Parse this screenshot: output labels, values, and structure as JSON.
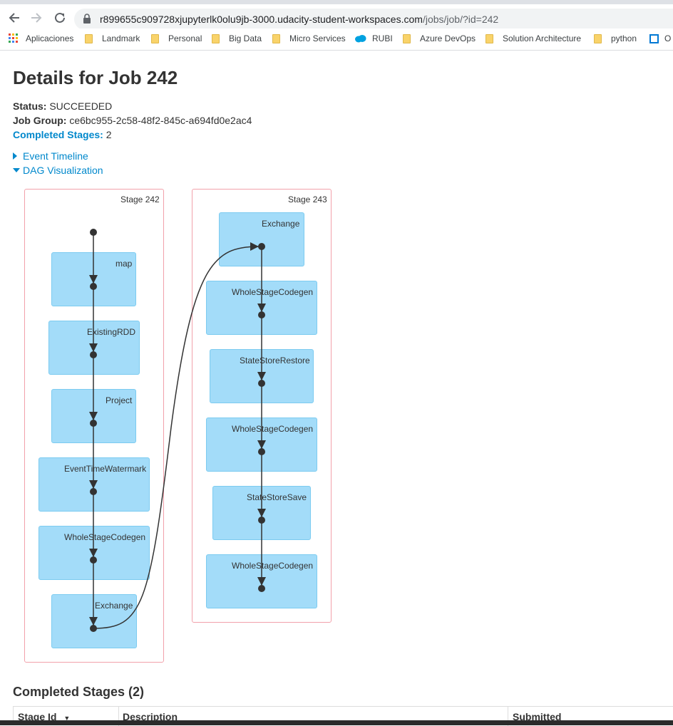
{
  "browser": {
    "url_host": "r899655c909728xjupyterlk0olu9jb-3000.udacity-student-workspaces.com",
    "url_path": "/jobs/job/?id=242",
    "bookmarks": [
      {
        "label": "Aplicaciones",
        "icon": "apps-grid-icon"
      },
      {
        "label": "Landmark",
        "icon": "folder-icon"
      },
      {
        "label": "Personal",
        "icon": "folder-icon"
      },
      {
        "label": "Big Data",
        "icon": "folder-icon"
      },
      {
        "label": "Micro Services",
        "icon": "folder-icon"
      },
      {
        "label": "RUBI",
        "icon": "salesforce-cloud-icon"
      },
      {
        "label": "Azure DevOps",
        "icon": "folder-icon"
      },
      {
        "label": "Solution Architecture",
        "icon": "folder-icon"
      },
      {
        "label": "python",
        "icon": "folder-icon"
      },
      {
        "label": "O",
        "icon": "outlook-icon"
      }
    ]
  },
  "page": {
    "title": "Details for Job 242",
    "status_label": "Status:",
    "status_value": "SUCCEEDED",
    "job_group_label": "Job Group:",
    "job_group_value": "ce6bc955-2c58-48f2-845c-a694fd0e2ac4",
    "completed_stages_label": "Completed Stages:",
    "completed_stages_value": "2",
    "event_timeline": "Event Timeline",
    "dag_visualization": "DAG Visualization"
  },
  "dag": {
    "stages": [
      {
        "label": "Stage 242",
        "ops": [
          "map",
          "ExistingRDD",
          "Project",
          "EventTimeWatermark",
          "WholeStageCodegen",
          "Exchange"
        ]
      },
      {
        "label": "Stage 243",
        "ops": [
          "Exchange",
          "WholeStageCodegen",
          "StateStoreRestore",
          "WholeStageCodegen",
          "StateStoreSave",
          "WholeStageCodegen"
        ]
      }
    ]
  },
  "completed_stages": {
    "title": "Completed Stages (2)",
    "columns": [
      "Stage Id",
      "Description",
      "Submitted"
    ]
  },
  "colors": {
    "link": "#0088cc",
    "stage_border": "#f2a1ab",
    "op_fill": "#a3dcf9",
    "edge": "#333333"
  }
}
